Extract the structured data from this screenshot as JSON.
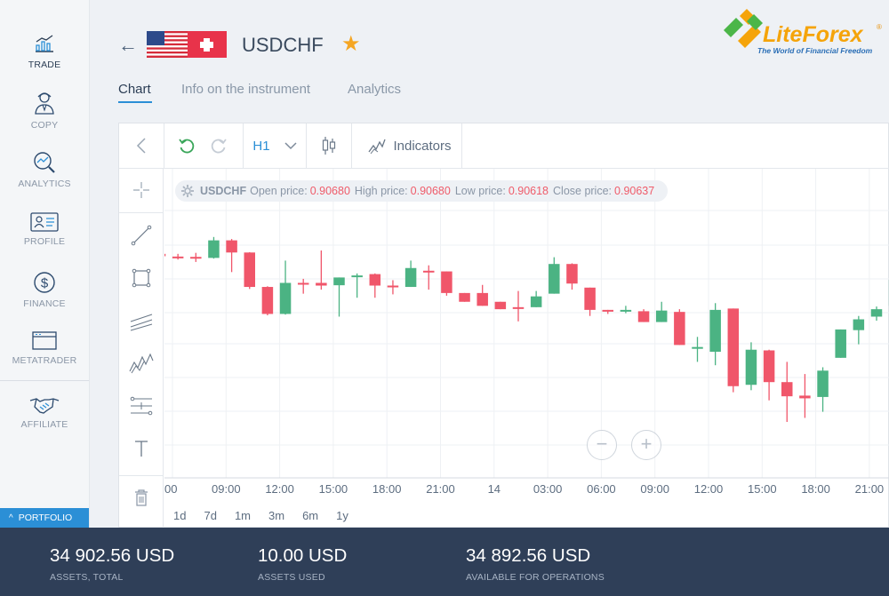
{
  "sidebar": {
    "items": [
      {
        "label": "TRADE"
      },
      {
        "label": "COPY"
      },
      {
        "label": "ANALYTICS"
      },
      {
        "label": "PROFILE"
      },
      {
        "label": "FINANCE"
      },
      {
        "label": "METATRADER"
      },
      {
        "label": "AFFILIATE"
      }
    ],
    "portfolio_label": "PORTFOLIO"
  },
  "header": {
    "symbol": "USDCHF"
  },
  "logo": {
    "name_part1": "Lite",
    "name_part2": "Forex",
    "tagline": "The World of Financial Freedom"
  },
  "tabs": [
    {
      "label": "Chart"
    },
    {
      "label": "Info on the instrument"
    },
    {
      "label": "Analytics"
    }
  ],
  "toolbar": {
    "timeframe": "H1",
    "indicators_label": "Indicators"
  },
  "ohlc": {
    "symbol": "USDCHF",
    "open_label": "Open price:",
    "open": "0.90680",
    "high_label": "High price:",
    "high": "0.90680",
    "low_label": "Low price:",
    "low": "0.90618",
    "close_label": "Close price:",
    "close": "0.90637"
  },
  "chart_data": {
    "type": "candlestick",
    "x_tick_labels": [
      "00",
      "09:00",
      "12:00",
      "15:00",
      "18:00",
      "21:00",
      "14",
      "03:00",
      "06:00",
      "09:00",
      "12:00",
      "15:00",
      "18:00",
      "21:00"
    ],
    "up_color": "#4bb383",
    "down_color": "#f0566a",
    "candles": [
      {
        "dir": "down",
        "open": 0.9,
        "close": 0.83,
        "high": 0.96,
        "low": 0.76
      },
      {
        "dir": "down",
        "open": 0.82,
        "close": 0.81,
        "high": 0.9,
        "low": 0.73
      },
      {
        "dir": "down",
        "open": 0.81,
        "close": 0.78,
        "high": 0.93,
        "low": 0.66
      },
      {
        "dir": "up",
        "open": 0.78,
        "close": 1.3,
        "high": 1.4,
        "low": 0.76
      },
      {
        "dir": "down",
        "open": 1.3,
        "close": 0.94,
        "high": 1.34,
        "low": 0.36
      },
      {
        "dir": "down",
        "open": 0.94,
        "close": -0.08,
        "high": 0.95,
        "low": -0.14
      },
      {
        "dir": "down",
        "open": -0.08,
        "close": -0.88,
        "high": -0.06,
        "low": -0.92
      },
      {
        "dir": "up",
        "open": -0.88,
        "close": 0.04,
        "high": 0.7,
        "low": -0.9
      },
      {
        "dir": "down",
        "open": 0.04,
        "close": 0.04,
        "high": 0.16,
        "low": -0.28
      },
      {
        "dir": "down",
        "open": 0.04,
        "close": -0.04,
        "high": 1.0,
        "low": -0.16
      },
      {
        "dir": "up",
        "open": -0.03,
        "close": 0.2,
        "high": 0.2,
        "low": -0.96
      },
      {
        "dir": "up",
        "open": 0.26,
        "close": 0.26,
        "high": 0.32,
        "low": -0.4
      },
      {
        "dir": "down",
        "open": 0.3,
        "close": -0.04,
        "high": 0.32,
        "low": -0.4
      },
      {
        "dir": "down",
        "open": -0.04,
        "close": -0.08,
        "high": 0.12,
        "low": -0.3
      },
      {
        "dir": "up",
        "open": -0.08,
        "close": 0.48,
        "high": 0.7,
        "low": -0.08
      },
      {
        "dir": "down",
        "open": 0.4,
        "close": 0.4,
        "high": 0.56,
        "low": -0.16
      },
      {
        "dir": "down",
        "open": 0.38,
        "close": -0.26,
        "high": 0.38,
        "low": -0.34
      },
      {
        "dir": "down",
        "open": -0.26,
        "close": -0.52,
        "high": -0.26,
        "low": -0.52
      },
      {
        "dir": "down",
        "open": -0.26,
        "close": -0.64,
        "high": -0.02,
        "low": -0.64
      },
      {
        "dir": "down",
        "open": -0.52,
        "close": -0.74,
        "high": -0.52,
        "low": -0.74
      },
      {
        "dir": "down",
        "open": -0.68,
        "close": -0.68,
        "high": -0.2,
        "low": -1.1
      },
      {
        "dir": "up",
        "open": -0.68,
        "close": -0.36,
        "high": -0.2,
        "low": -0.68
      },
      {
        "dir": "up",
        "open": -0.28,
        "close": 0.6,
        "high": 0.8,
        "low": -0.28
      },
      {
        "dir": "down",
        "open": 0.6,
        "close": 0.02,
        "high": 0.62,
        "low": -0.16
      },
      {
        "dir": "down",
        "open": -0.1,
        "close": -0.76,
        "high": -0.1,
        "low": -0.94
      },
      {
        "dir": "down",
        "open": -0.76,
        "close": -0.8,
        "high": -0.76,
        "low": -0.88
      },
      {
        "dir": "up",
        "open": -0.76,
        "close": -0.76,
        "high": -0.64,
        "low": -0.86
      },
      {
        "dir": "down",
        "open": -0.8,
        "close": -1.12,
        "high": -0.74,
        "low": -1.12
      },
      {
        "dir": "up",
        "open": -1.12,
        "close": -0.78,
        "high": -0.52,
        "low": -1.12
      },
      {
        "dir": "down",
        "open": -0.82,
        "close": -1.8,
        "high": -0.74,
        "low": -1.8
      },
      {
        "dir": "up",
        "open": -1.86,
        "close": -1.86,
        "high": -1.56,
        "low": -2.3
      },
      {
        "dir": "up",
        "open": -2.0,
        "close": -0.76,
        "high": -0.56,
        "low": -2.4
      },
      {
        "dir": "down",
        "open": -0.72,
        "close": -3.02,
        "high": -0.72,
        "low": -3.2
      },
      {
        "dir": "up",
        "open": -2.98,
        "close": -1.94,
        "high": -1.72,
        "low": -3.14
      },
      {
        "dir": "down",
        "open": -1.96,
        "close": -2.9,
        "high": -1.94,
        "low": -3.44
      },
      {
        "dir": "down",
        "open": -2.9,
        "close": -3.32,
        "high": -2.3,
        "low": -4.08
      },
      {
        "dir": "down",
        "open": -3.3,
        "close": -3.38,
        "high": -2.66,
        "low": -3.96
      },
      {
        "dir": "up",
        "open": -3.34,
        "close": -2.56,
        "high": -2.46,
        "low": -3.78
      },
      {
        "dir": "up",
        "open": -2.18,
        "close": -1.34,
        "high": -1.34,
        "low": -2.18
      },
      {
        "dir": "up",
        "open": -1.36,
        "close": -1.04,
        "high": -0.94,
        "low": -1.78
      },
      {
        "dir": "up",
        "open": -0.96,
        "close": -0.74,
        "high": -0.66,
        "low": -1.08
      },
      {
        "dir": "up",
        "open": -0.64,
        "close": 0.14,
        "high": 0.14,
        "low": -0.64
      }
    ]
  },
  "range_buttons": [
    "1d",
    "7d",
    "1m",
    "3m",
    "6m",
    "1y"
  ],
  "bottom": {
    "assets_total": "34 902.56 USD",
    "assets_total_label": "ASSETS, TOTAL",
    "assets_used": "10.00 USD",
    "assets_used_label": "ASSETS USED",
    "available": "34 892.56 USD",
    "available_label": "AVAILABLE FOR OPERATIONS"
  }
}
